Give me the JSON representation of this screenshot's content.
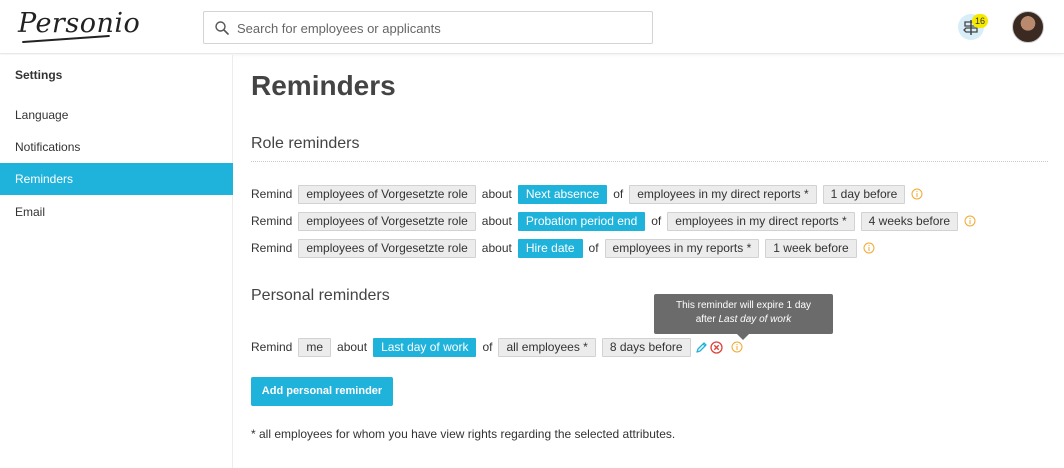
{
  "header": {
    "logo_text": "Personio",
    "search_placeholder": "Search for employees or applicants",
    "notification_count": "16"
  },
  "sidebar": {
    "title": "Settings",
    "items": [
      {
        "label": "Language",
        "active": false
      },
      {
        "label": "Notifications",
        "active": false
      },
      {
        "label": "Reminders",
        "active": true
      },
      {
        "label": "Email",
        "active": false
      }
    ]
  },
  "main": {
    "title": "Reminders",
    "role_section_title": "Role reminders",
    "personal_section_title": "Personal reminders",
    "role_reminders": [
      {
        "remind": "Remind",
        "who": "employees of Vorgesetzte role",
        "about": "about",
        "event": "Next absence",
        "of": "of",
        "target": "employees in my direct reports *",
        "timing": "1 day before"
      },
      {
        "remind": "Remind",
        "who": "employees of Vorgesetzte role",
        "about": "about",
        "event": "Probation period end",
        "of": "of",
        "target": "employees in my direct reports *",
        "timing": "4 weeks before"
      },
      {
        "remind": "Remind",
        "who": "employees of Vorgesetzte role",
        "about": "about",
        "event": "Hire date",
        "of": "of",
        "target": "employees in my reports *",
        "timing": "1 week before"
      }
    ],
    "personal_reminders": [
      {
        "remind": "Remind",
        "who": "me",
        "about": "about",
        "event": "Last day of work",
        "of": "of",
        "target": "all employees *",
        "timing": "8 days before"
      }
    ],
    "tooltip": {
      "line1": "This reminder will expire 1 day",
      "line2_prefix": "after ",
      "line2_emph": "Last day of work"
    },
    "add_button_label": "Add personal reminder",
    "footnote": "* all employees for whom you have view rights regarding the selected attributes."
  },
  "colors": {
    "accent": "#1fb3dc",
    "info": "#f0a830",
    "delete": "#e0443c",
    "badge": "#f5e900"
  }
}
